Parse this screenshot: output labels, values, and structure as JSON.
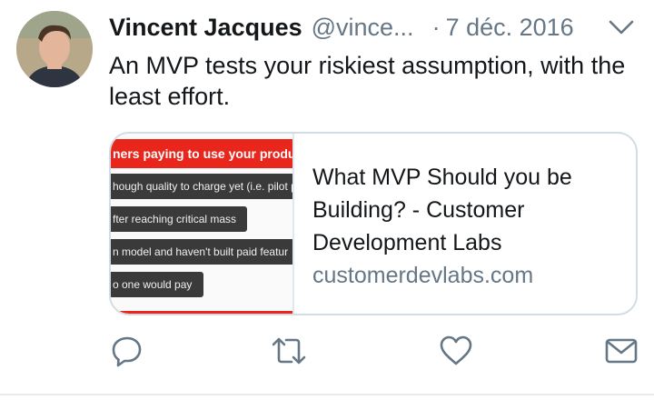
{
  "tweet": {
    "author_name": "Vincent Jacques",
    "author_handle": "@vince...",
    "separator": "·",
    "date": "7 déc. 2016",
    "text": "An MVP tests your riskiest assumption, with the least effort.",
    "menu_icon": "chevron-down-icon"
  },
  "card": {
    "title": "What MVP Should you be Building? - Customer Development Labs",
    "domain": "customerdevlabs.com",
    "image": {
      "banner": "ners paying to use your product",
      "pills": [
        "hough quality to charge yet (i.e. pilot p",
        "fter reaching critical mass",
        "n model and haven't built paid featur",
        "o one would pay"
      ]
    }
  },
  "actions": [
    {
      "icon": "reply-icon"
    },
    {
      "icon": "retweet-icon"
    },
    {
      "icon": "like-icon"
    },
    {
      "icon": "direct-message-icon"
    }
  ],
  "colors": {
    "text": "#14171a",
    "muted": "#657786",
    "card_border": "#d0dde4",
    "banner_red": "#e8261c",
    "pill_dark": "#3a3a3a"
  }
}
